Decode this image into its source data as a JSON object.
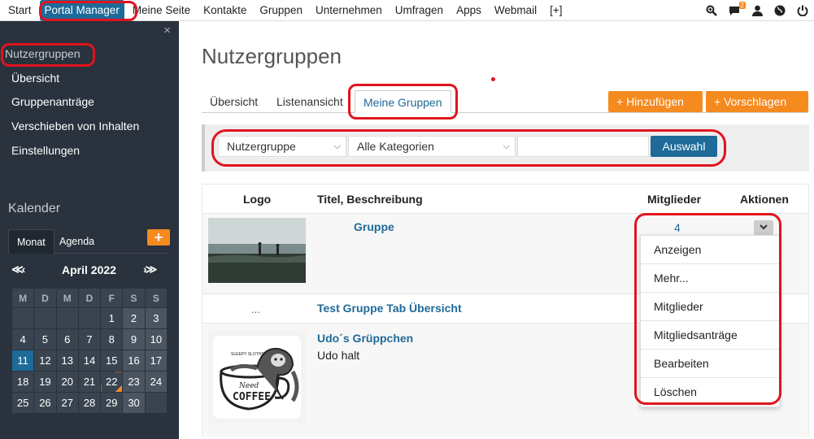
{
  "topnav": {
    "items": [
      "Start",
      "Portal Manager",
      "Meine Seite",
      "Kontakte",
      "Gruppen",
      "Unternehmen",
      "Umfragen",
      "Apps",
      "Webmail",
      "[+]"
    ],
    "active_index": 1,
    "notification_count": "2",
    "icons": [
      "search-zoom-icon",
      "chat-bubble-icon",
      "user-icon",
      "globe-icon",
      "power-icon"
    ]
  },
  "sidebar": {
    "close_glyph": "×",
    "heading": "Nutzergruppen",
    "items": [
      "Übersicht",
      "Gruppenanträge",
      "Verschieben von Inhalten",
      "Einstellungen"
    ]
  },
  "calendar": {
    "title": "Kalender",
    "tabs": [
      "Monat",
      "Agenda"
    ],
    "month_label": "April 2022",
    "prev_glyph": "≪‹",
    "next_glyph": "›≫",
    "weekdays": [
      "M",
      "D",
      "M",
      "D",
      "F",
      "S",
      "S"
    ],
    "weeks": [
      [
        "",
        "",
        "",
        "",
        "1",
        "2",
        "3"
      ],
      [
        "4",
        "5",
        "6",
        "7",
        "8",
        "9",
        "10"
      ],
      [
        "11",
        "12",
        "13",
        "14",
        "15",
        "16",
        "17"
      ],
      [
        "18",
        "19",
        "20",
        "21",
        "22",
        "23",
        "24"
      ],
      [
        "25",
        "26",
        "27",
        "28",
        "29",
        "30",
        ""
      ]
    ],
    "today": "11"
  },
  "main": {
    "title": "Nutzergruppen",
    "tabs": [
      "Übersicht",
      "Listenansicht",
      "Meine Gruppen"
    ],
    "selected_tab": 2,
    "add_button": "+ Hinzufügen",
    "suggest_button": "+ Vorschlagen"
  },
  "filter": {
    "group_select": "Nutzergruppe",
    "category_select": "Alle Kategorien",
    "search_value": "",
    "submit": "Auswahl"
  },
  "table": {
    "headers": [
      "Logo",
      "Titel, Beschreibung",
      "Mitglieder",
      "Aktionen"
    ],
    "rows": [
      {
        "title": "Gruppe",
        "description": "",
        "members": "4",
        "logo": "photo"
      },
      {
        "title": "Test Gruppe Tab Übersicht",
        "description": "",
        "members": "",
        "logo": "..."
      },
      {
        "title": "Udo´s Grüppchen",
        "description": "Udo halt",
        "members": "",
        "logo": "coffee"
      }
    ]
  },
  "actions_menu": {
    "items": [
      "Anzeigen",
      "Mehr...",
      "Mitglieder",
      "Mitgliedsanträge",
      "Bearbeiten",
      "Löschen"
    ]
  },
  "logo_text": {
    "coffee_word": "COFFEE",
    "coffee_script": "Need",
    "coffee_top": "SLEEPY SLOTHS"
  },
  "colors": {
    "accent_blue": "#1e6a98",
    "accent_orange": "#f58a1f",
    "sidebar_bg": "#29323d",
    "highlight_red": "#e0141e"
  }
}
